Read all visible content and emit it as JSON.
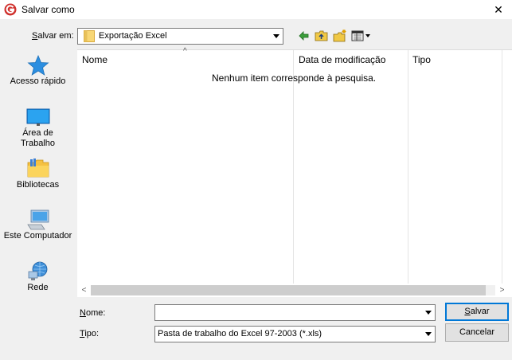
{
  "window": {
    "title": "Salvar como",
    "close_glyph": "✕"
  },
  "save_in": {
    "label_prefix": "S",
    "label_rest": "alvar em:",
    "value": "Exportação Excel"
  },
  "toolbar": {
    "icons": [
      "back-arrow-icon",
      "up-folder-icon",
      "new-folder-icon",
      "view-menu-icon"
    ]
  },
  "places": [
    {
      "label_line1": "Acesso rápido",
      "label_line2": "",
      "icon": "star-icon"
    },
    {
      "label_line1": "Área de",
      "label_line2": "Trabalho",
      "icon": "desktop-icon"
    },
    {
      "label_line1": "Bibliotecas",
      "label_line2": "",
      "icon": "libraries-icon"
    },
    {
      "label_line1": "Este Computador",
      "label_line2": "",
      "icon": "computer-icon"
    },
    {
      "label_line1": "Rede",
      "label_line2": "",
      "icon": "network-icon"
    }
  ],
  "file_list": {
    "columns": [
      "Nome",
      "Data de modificação",
      "Tipo"
    ],
    "sort_indicator": "^",
    "empty_message": "Nenhum item corresponde à pesquisa.",
    "rows": []
  },
  "name_field": {
    "label_prefix": "N",
    "label_rest": "ome:",
    "value": ""
  },
  "type_field": {
    "label_prefix": "T",
    "label_rest": "ipo:",
    "value": "Pasta de trabalho do Excel 97-2003 (*.xls)"
  },
  "buttons": {
    "save_prefix": "S",
    "save_rest": "alvar",
    "cancel": "Cancelar"
  },
  "colors": {
    "accent": "#0078d7",
    "app_icon_red": "#d0312d",
    "folder_yellow": "#f8d775"
  }
}
